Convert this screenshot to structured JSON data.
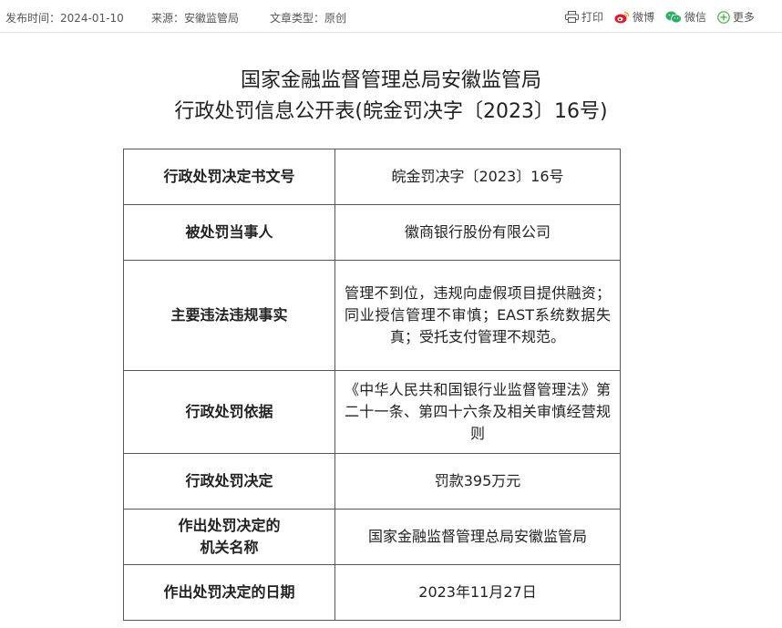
{
  "meta": {
    "publish_time": "发布时间：2024-01-10",
    "source": "来源：安徽监管局",
    "article_type": "文章类型：原创"
  },
  "share": {
    "print": "打印",
    "weibo": "微博",
    "wechat": "微信",
    "more": "更多"
  },
  "title": {
    "line1": "国家金融监督管理总局安徽监管局",
    "line2": "行政处罚信息公开表(皖金罚决字〔2023〕16号)"
  },
  "rows": [
    {
      "label": "行政处罚决定书文号",
      "value": "皖金罚决字〔2023〕16号"
    },
    {
      "label": "被处罚当事人",
      "value": "徽商银行股份有限公司"
    },
    {
      "label": "主要违法违规事实",
      "value": "管理不到位，违规向虚假项目提供融资；同业授信管理不审慎；EAST系统数据失真；受托支付管理不规范。"
    },
    {
      "label": "行政处罚依据",
      "value": "《中华人民共和国银行业监督管理法》第二十一条、第四十六条及相关审慎经营规则"
    },
    {
      "label": "行政处罚决定",
      "value": "罚款395万元"
    },
    {
      "label_line1": "作出处罚决定的",
      "label_line2": "机关名称",
      "value": "国家金融监督管理总局安徽监管局"
    },
    {
      "label": "作出处罚决定的日期",
      "value": "2023年11月27日"
    }
  ],
  "colors": {
    "border": "#555555",
    "topbar_border": "#e2e2e2",
    "weibo": "#e6162d",
    "wechat": "#2aae67",
    "more": "#3cb043"
  }
}
